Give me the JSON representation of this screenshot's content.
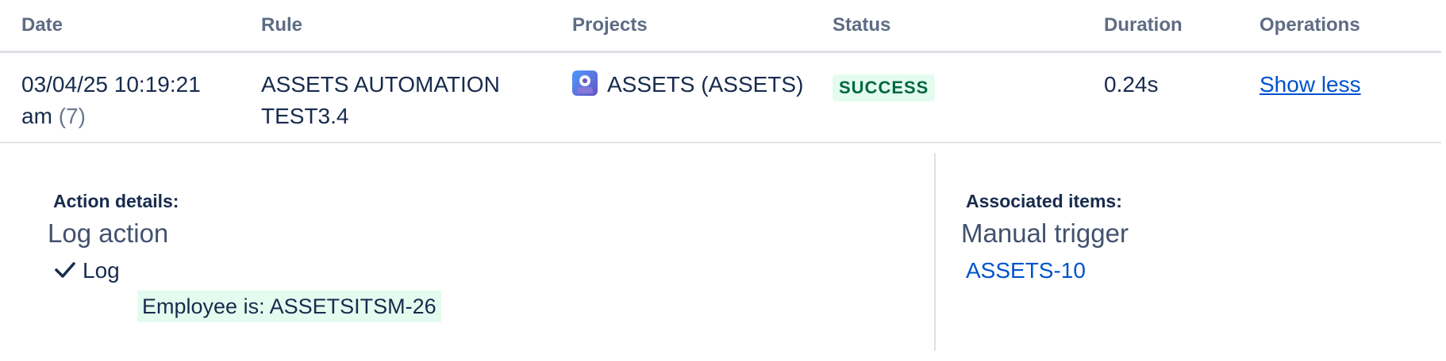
{
  "table": {
    "headers": [
      "Date",
      "Rule",
      "Projects",
      "Status",
      "Duration",
      "Operations"
    ],
    "row": {
      "date_line1": "03/04/25 10:19:21",
      "date_line2": "am",
      "count": "(7)",
      "rule_line1": "ASSETS AUTOMATION",
      "rule_line2": "TEST3.4",
      "project": "ASSETS (ASSETS)",
      "project_icon": "assets-project-icon",
      "status": "SUCCESS",
      "duration": "0.24s",
      "operation": "Show less"
    }
  },
  "details": {
    "action_label": "Action details:",
    "action_name": "Log action",
    "step": "Log",
    "step_icon": "check-icon",
    "log_message": "Employee is: ASSETSITSM-26",
    "associated_label": "Associated items:",
    "trigger": "Manual trigger",
    "issue_key": "ASSETS-10"
  },
  "colors": {
    "link": "#0052cc",
    "success_bg": "#e3fcef",
    "success_text": "#006644",
    "header_text": "#5e6c84",
    "divider": "#dfe1e6"
  }
}
